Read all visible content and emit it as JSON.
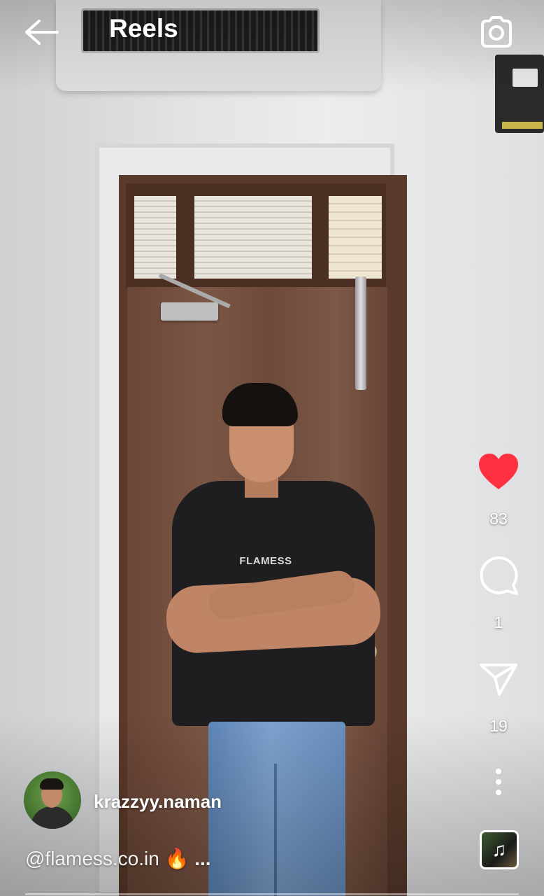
{
  "header": {
    "title": "Reels"
  },
  "reel": {
    "shirt_print": "FLAMESS",
    "owner": {
      "username": "krazzyy.naman"
    },
    "caption": {
      "text": "@flamess.co.in 🔥",
      "more": "..."
    },
    "actions": {
      "likes": "83",
      "comments": "1",
      "shares": "19"
    }
  },
  "icons": {
    "back": "back-arrow-icon",
    "camera": "camera-icon",
    "like": "heart-icon",
    "comment": "comment-icon",
    "share": "send-icon",
    "more": "more-vertical-icon",
    "audio": "music-note-icon"
  },
  "colors": {
    "like_active": "#ff3040",
    "icon": "#ffffff"
  }
}
